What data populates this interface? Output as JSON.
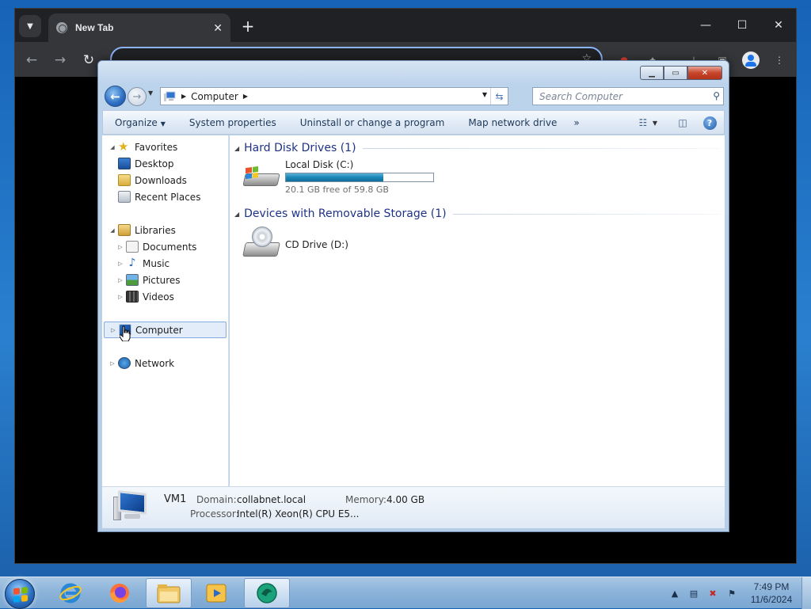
{
  "chrome": {
    "tab_title": "New Tab",
    "close_tab": "✕",
    "new_tab": "+",
    "minimize": "—",
    "maximize": "☐",
    "close": "✕"
  },
  "explorer": {
    "breadcrumb": {
      "root": "Computer"
    },
    "search_placeholder": "Search Computer",
    "commands": {
      "organize": "Organize",
      "system_properties": "System properties",
      "uninstall": "Uninstall or change a program",
      "map_drive": "Map network drive",
      "more": "»"
    },
    "nav": {
      "favorites": "Favorites",
      "desktop": "Desktop",
      "downloads": "Downloads",
      "recent_places": "Recent Places",
      "libraries": "Libraries",
      "documents": "Documents",
      "music": "Music",
      "pictures": "Pictures",
      "videos": "Videos",
      "computer": "Computer",
      "network": "Network"
    },
    "groups": {
      "hdd": "Hard Disk Drives (1)",
      "removable": "Devices with Removable Storage (1)"
    },
    "drives": {
      "c_name": "Local Disk (C:)",
      "c_free": "20.1 GB free of 59.8 GB",
      "c_used_fraction": 0.66,
      "d_name": "CD Drive (D:)"
    },
    "details": {
      "computer_name": "VM1",
      "domain_label": "Domain:",
      "domain_value": "collabnet.local",
      "memory_label": "Memory:",
      "memory_value": "4.00 GB",
      "processor_label": "Processor:",
      "processor_value": "Intel(R) Xeon(R) CPU E5..."
    }
  },
  "taskbar": {
    "time": "7:49 PM",
    "date": "11/6/2024",
    "pinned": [
      "internet-explorer",
      "firefox",
      "windows-explorer",
      "media-player",
      "chrome-remote"
    ]
  },
  "colors": {
    "accent": "#1e3287",
    "selection": "#e3edf9",
    "progress": "#1b86b5"
  }
}
